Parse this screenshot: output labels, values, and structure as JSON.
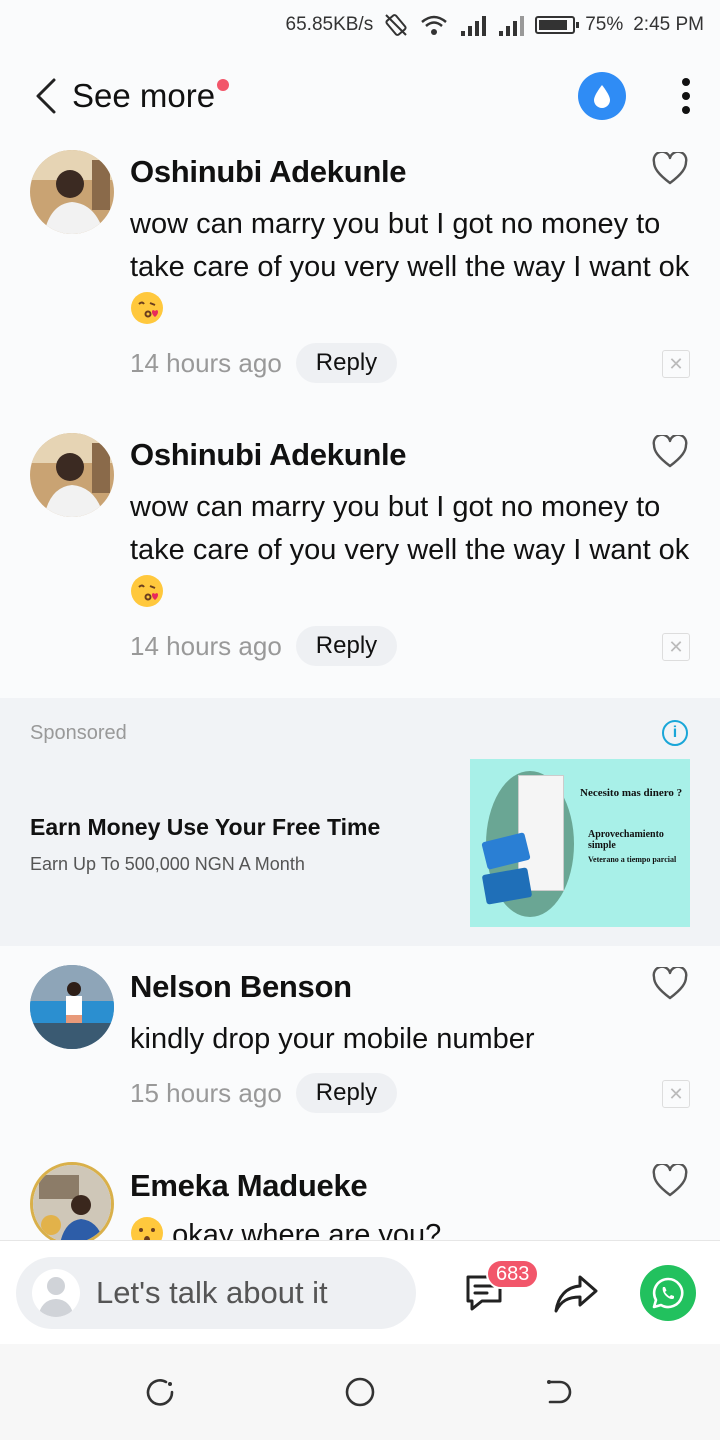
{
  "status_bar": {
    "speed": "65.85KB/s",
    "battery": "75%",
    "time": "2:45 PM"
  },
  "header": {
    "title": "See more"
  },
  "comments": [
    {
      "name": "Oshinubi Adekunle",
      "text": "wow can marry you but I got no money to take care of you very well the way I want ok",
      "time": "14 hours ago",
      "reply": "Reply"
    },
    {
      "name": "Oshinubi Adekunle",
      "text": "wow can marry you but I got no money to take care of you very well the way I want ok",
      "time": "14 hours ago",
      "reply": "Reply"
    },
    {
      "name": "Nelson Benson",
      "text": "kindly drop your mobile number",
      "time": "15 hours ago",
      "reply": "Reply"
    },
    {
      "name": "Emeka Madueke",
      "text": "okay where are you?"
    }
  ],
  "sponsored": {
    "label": "Sponsored",
    "title": "Earn Money Use Your Free Time",
    "subtitle": "Earn Up To 500,000 NGN A Month",
    "image_text": {
      "line1": "Necesito mas dinero ?",
      "line2": "Aprovechamiento simple",
      "line3": "Veterano a tiempo parcial"
    }
  },
  "bottom_bar": {
    "placeholder": "Let's talk about it",
    "comment_count": "683"
  },
  "colors": {
    "accent_blue": "#2f8cf5",
    "badge_red": "#f2566a",
    "whatsapp_green": "#22c15e"
  }
}
